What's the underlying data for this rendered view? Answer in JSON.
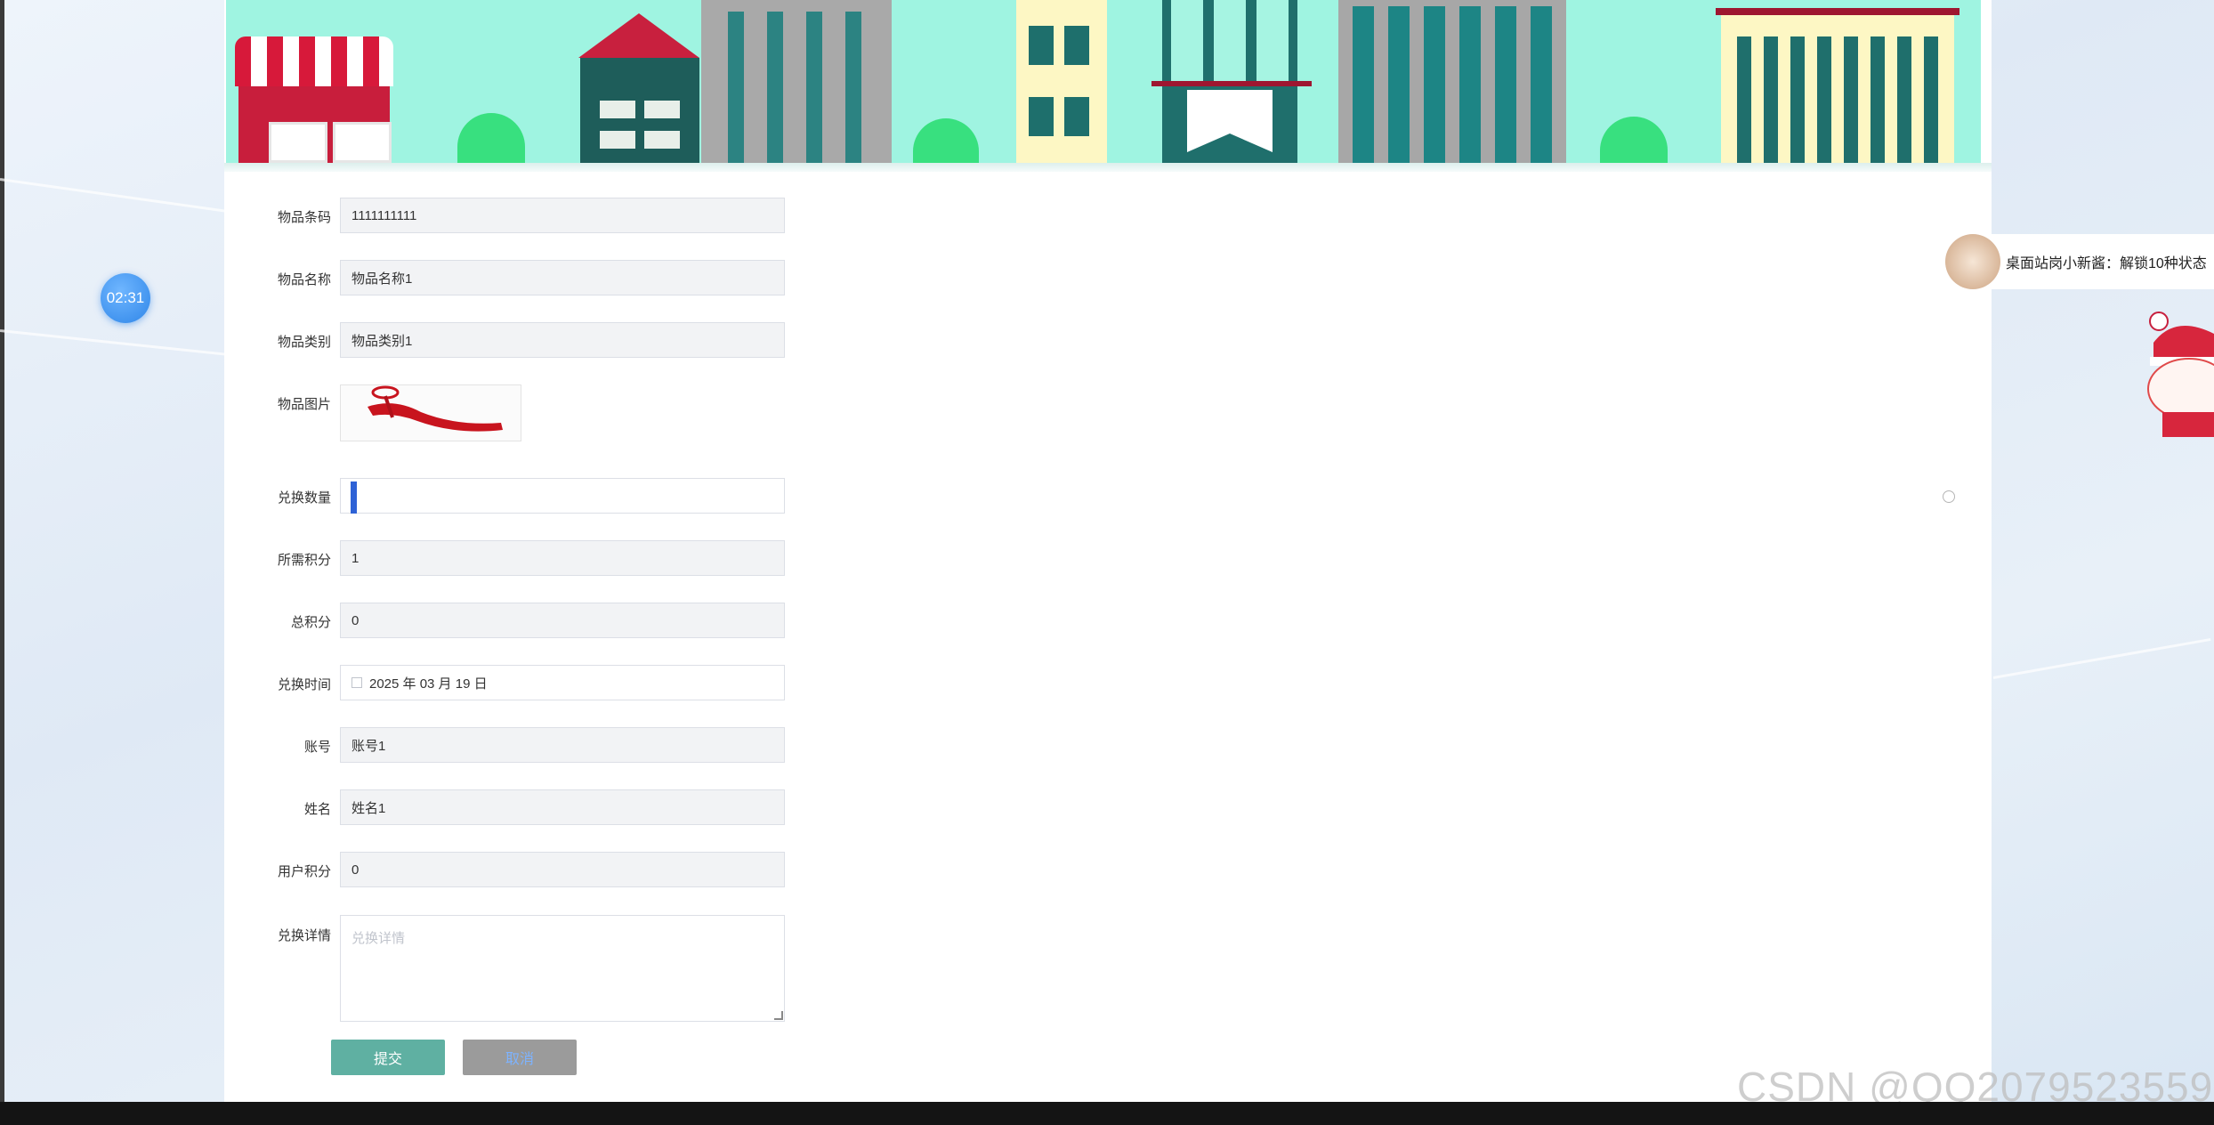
{
  "timer": "02:31",
  "form": {
    "fields": [
      {
        "label": "物品条码",
        "value": "1111111111"
      },
      {
        "label": "物品名称",
        "value": "物品名称1"
      },
      {
        "label": "物品类别",
        "value": "物品类别1"
      },
      {
        "label": "物品图片"
      },
      {
        "label": "兑换数量",
        "value": ""
      },
      {
        "label": "所需积分",
        "value": "1"
      },
      {
        "label": "总积分",
        "value": "0"
      },
      {
        "label": "兑换时间",
        "value": "2025 年 03 月 19 日"
      },
      {
        "label": "账号",
        "value": "账号1"
      },
      {
        "label": "姓名",
        "value": "姓名1"
      },
      {
        "label": "用户积分",
        "value": "0"
      },
      {
        "label": "兑换详情",
        "placeholder": "兑换详情"
      }
    ],
    "submit_label": "提交",
    "cancel_label": "取消"
  },
  "notification": {
    "text": "桌面站岗小新酱：解锁10种状态"
  },
  "watermark": "CSDN @QQ2079523559",
  "colors": {
    "banner": "#9ff4e1",
    "submit": "#5fb0a2",
    "cancel": "#9b9b9b",
    "timer": "#2f86e8"
  }
}
